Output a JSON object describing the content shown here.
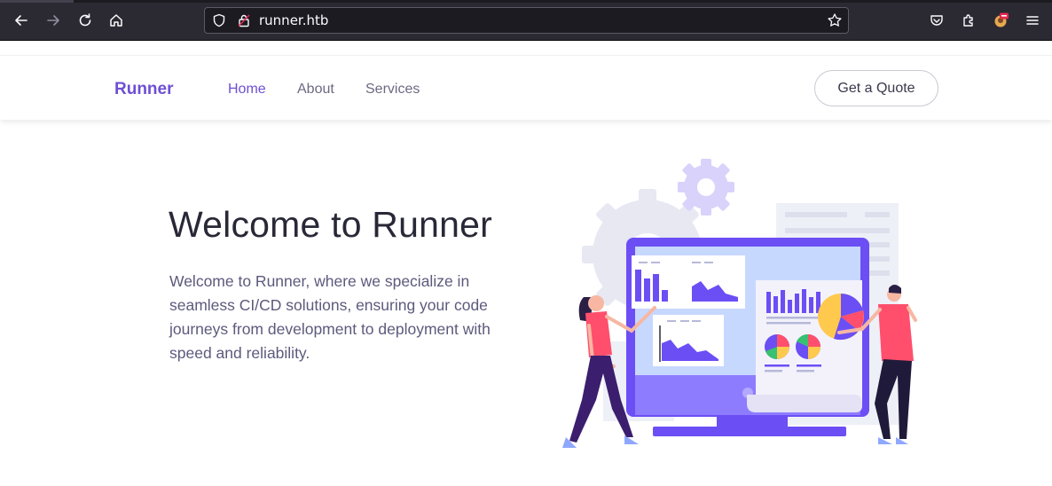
{
  "browser": {
    "url": "runner.htb",
    "icons": [
      "back-arrow-icon",
      "forward-arrow-icon",
      "reload-icon",
      "home-icon",
      "shield-icon",
      "lock-icon",
      "star-icon",
      "pocket-icon",
      "extensions-icon",
      "profile-avatar-icon",
      "menu-icon"
    ]
  },
  "navbar": {
    "brand": "Runner",
    "links": [
      "Home",
      "About",
      "Services"
    ],
    "active": "Home",
    "cta": "Get a Quote"
  },
  "hero": {
    "title": "Welcome to Runner",
    "text": "Welcome to Runner, where we specialize in seamless CI/CD solutions, ensuring your code journeys from development to deployment with speed and reliability."
  },
  "colors": {
    "accent": "#6e4fd3",
    "chrome_bg": "#2b2a33",
    "illustration_purple": "#6c4ef5",
    "illustration_pink": "#ff4f6d"
  }
}
